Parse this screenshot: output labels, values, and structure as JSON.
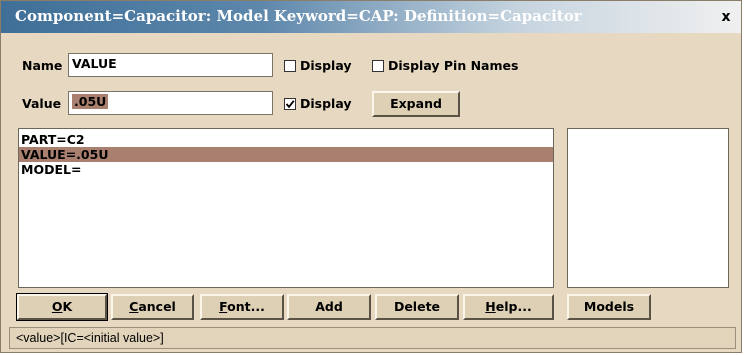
{
  "window": {
    "title": "Component=Capacitor: Model Keyword=CAP: Definition=Capacitor",
    "close_glyph": "x"
  },
  "name_row": {
    "label": "Name",
    "value": "VALUE",
    "display_label": "Display",
    "display_checked": false,
    "pin_names_label": "Display Pin Names",
    "pin_names_checked": false
  },
  "value_row": {
    "label": "Value",
    "value": ".05U",
    "display_label": "Display",
    "display_checked": true,
    "expand_label": "Expand"
  },
  "attributes": [
    {
      "text": "PART=C2",
      "selected": false
    },
    {
      "text": "VALUE=.05U",
      "selected": true
    },
    {
      "text": "MODEL=",
      "selected": false
    }
  ],
  "buttons": {
    "ok": {
      "mnemonic": "O",
      "rest": "K"
    },
    "cancel": {
      "mnemonic": "C",
      "rest": "ancel"
    },
    "font": {
      "mnemonic": "F",
      "rest": "ont..."
    },
    "add": "Add",
    "delete": "Delete",
    "help": {
      "mnemonic": "H",
      "rest": "elp..."
    },
    "models": "Models"
  },
  "status_text": "<value>[IC=<initial value>]",
  "colors": {
    "selection": "#a98070",
    "dialog_bg": "#e7d9c1",
    "title_start": "#3f6f97"
  }
}
